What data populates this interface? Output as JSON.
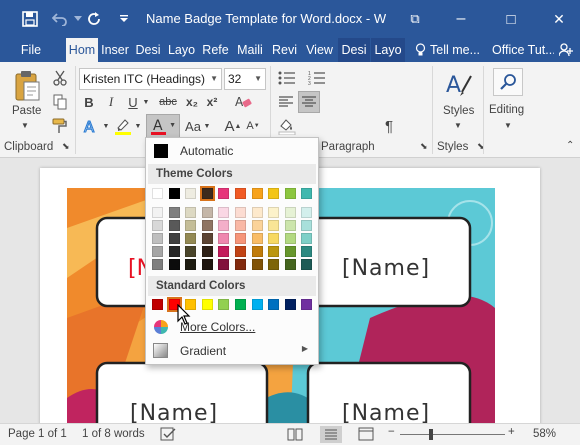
{
  "window": {
    "title": "Name Badge Template for Word.docx - W...",
    "minimize_glyph": "–",
    "maximize_glyph": "□",
    "close_glyph": "✕",
    "ribbon_toggle_glyph": "⧉"
  },
  "tabs": [
    {
      "label": "File"
    },
    {
      "label": "Hom"
    },
    {
      "label": "Inser"
    },
    {
      "label": "Desi"
    },
    {
      "label": "Layo"
    },
    {
      "label": "Refe"
    },
    {
      "label": "Maili"
    },
    {
      "label": "Revi"
    },
    {
      "label": "View"
    },
    {
      "label": "Desi"
    },
    {
      "label": "Layo"
    },
    {
      "label": "Tell me..."
    },
    {
      "label": "Office Tut..."
    }
  ],
  "ribbon": {
    "paste_label": "Paste",
    "clipboard_group": "Clipboard",
    "font_name": "Kristen ITC (Headings)",
    "font_size": "32",
    "paragraph_group": "Paragraph",
    "styles_label": "Styles",
    "styles_group": "Styles",
    "editing_label": "Editing",
    "bold": "B",
    "italic": "I",
    "underline": "U",
    "strike": "abc",
    "subscript": "x₂",
    "superscript": "x²",
    "font_color_letter": "A",
    "change_case": "Aa",
    "grow": "A",
    "shrink": "A",
    "pilcrow": "¶",
    "font_color_underline": "#e81123",
    "accent": "#2b579a"
  },
  "document": {
    "badge_text": "[Name]",
    "partial_badge_text": "[N"
  },
  "dropdown": {
    "automatic_label": "Automatic",
    "theme_colors_label": "Theme Colors",
    "standard_colors_label": "Standard Colors",
    "more_colors_label": "More Colors...",
    "gradient_label": "Gradient",
    "selected_color": "#ff0000",
    "theme_top": [
      "#ffffff",
      "#000000",
      "#eeece1",
      "#3d2a1c",
      "#e6357a",
      "#f15a24",
      "#f7a21b",
      "#f3c515",
      "#8cc63f",
      "#3fb8af"
    ],
    "theme_shades": [
      [
        "#f2f2f2",
        "#7f7f7f",
        "#ddd9c3",
        "#c4b6a8",
        "#fad7e4",
        "#fcdcd2",
        "#fde9cc",
        "#fcf2ca",
        "#e6f2d5",
        "#d3efec"
      ],
      [
        "#d8d8d8",
        "#595959",
        "#c4bd97",
        "#8f7462",
        "#f4afc9",
        "#f9b8a5",
        "#fbd399",
        "#f9e596",
        "#cce5ab",
        "#a8e0db"
      ],
      [
        "#bfbfbf",
        "#3f3f3f",
        "#938953",
        "#5c4433",
        "#ef88af",
        "#f69579",
        "#f9bd66",
        "#f7d962",
        "#b3d981",
        "#7ed0c8"
      ],
      [
        "#a5a5a5",
        "#262626",
        "#494429",
        "#2d1f15",
        "#c31a5b",
        "#c14214",
        "#c07b0a",
        "#bb960c",
        "#66962b",
        "#2b8981"
      ],
      [
        "#7f7f7f",
        "#0c0c0c",
        "#1d1b10",
        "#1e150e",
        "#82113c",
        "#81290d",
        "#805207",
        "#7d6408",
        "#44641d",
        "#1d5b56"
      ]
    ],
    "standard": [
      "#c00000",
      "#ff0000",
      "#ffc000",
      "#ffff00",
      "#92d050",
      "#00b050",
      "#00b0f0",
      "#0070c0",
      "#002060",
      "#7030a0"
    ]
  },
  "status": {
    "page": "Page 1 of 1",
    "words": "1 of 8 words",
    "zoom": "58%",
    "zoom_minus": "−",
    "zoom_plus": "+"
  }
}
